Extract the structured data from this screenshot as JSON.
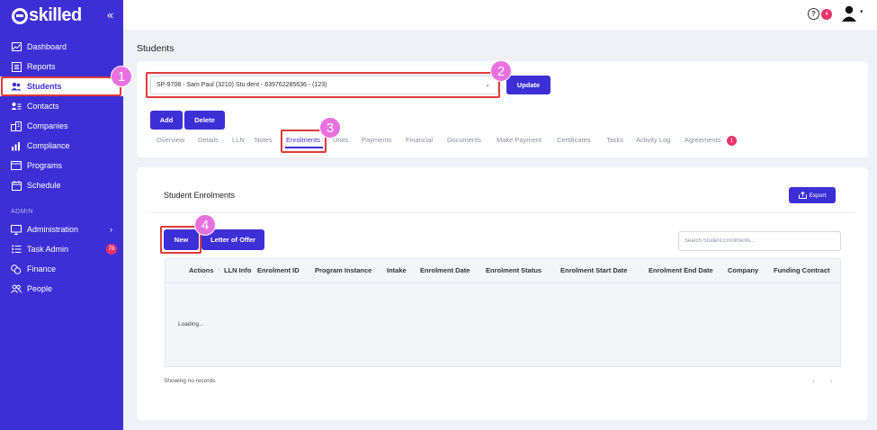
{
  "app": {
    "logo_text": "skilled",
    "collapse_icon": "double-chevron-left-icon"
  },
  "sidebar": {
    "items": [
      {
        "label": "Dashboard",
        "icon": "chart-line-icon"
      },
      {
        "label": "Reports",
        "icon": "report-icon"
      },
      {
        "label": "Students",
        "icon": "users-icon"
      },
      {
        "label": "Contacts",
        "icon": "contact-card-icon"
      },
      {
        "label": "Companies",
        "icon": "building-icon"
      },
      {
        "label": "Compliance",
        "icon": "bar-chart-icon"
      },
      {
        "label": "Programs",
        "icon": "window-icon"
      },
      {
        "label": "Schedule",
        "icon": "calendar-icon"
      }
    ],
    "admin_label": "ADMIN",
    "admin_items": [
      {
        "label": "Administration",
        "icon": "monitor-icon"
      },
      {
        "label": "Task Admin",
        "icon": "list-icon",
        "badge": "76"
      },
      {
        "label": "Finance",
        "icon": "coins-icon"
      },
      {
        "label": "People",
        "icon": "people-icon"
      }
    ]
  },
  "topbar": {
    "help": "?",
    "notification_count": "4"
  },
  "page": {
    "title": "Students"
  },
  "student_select": {
    "value": "SP-9708 - Sam Paul (3210) Stu dent - 639762285636 - (123)"
  },
  "buttons": {
    "update": "Update",
    "add": "Add",
    "delete": "Delete"
  },
  "tabs": [
    {
      "label": "Overview"
    },
    {
      "label": "Details"
    },
    {
      "label": "LLN"
    },
    {
      "label": "Notes"
    },
    {
      "label": "Enrolments"
    },
    {
      "label": "Units"
    },
    {
      "label": "Payments"
    },
    {
      "label": "Financial"
    },
    {
      "label": "Documents"
    },
    {
      "label": "Make Payment"
    },
    {
      "label": "Certificates"
    },
    {
      "label": "Tasks"
    },
    {
      "label": "Activity Log"
    },
    {
      "label": "Agreements"
    }
  ],
  "tab_badge": "1",
  "enrolments": {
    "title": "Student Enrolments",
    "export_label": "Export",
    "new_label": "New",
    "letter_label": "Letter of Offer",
    "search_placeholder": "Search Student Enrolments...",
    "columns": [
      "Actions",
      "LLN Info",
      "Enrolment ID",
      "Program Instance",
      "Intake",
      "Enrolment Date",
      "Enrolment Status",
      "Enrolment Start Date",
      "Enrolment End Date",
      "Company",
      "Funding Contract"
    ],
    "loading_text": "Loading...",
    "records_text": "Showing no records",
    "pager_prev": "‹",
    "pager_next": "›"
  },
  "annotations": [
    "1",
    "2",
    "3",
    "4"
  ],
  "colors": {
    "brand": "#3d2fd6",
    "badge": "#e8336b",
    "highlight": "#e03a3a",
    "marker": "#e870e0"
  }
}
